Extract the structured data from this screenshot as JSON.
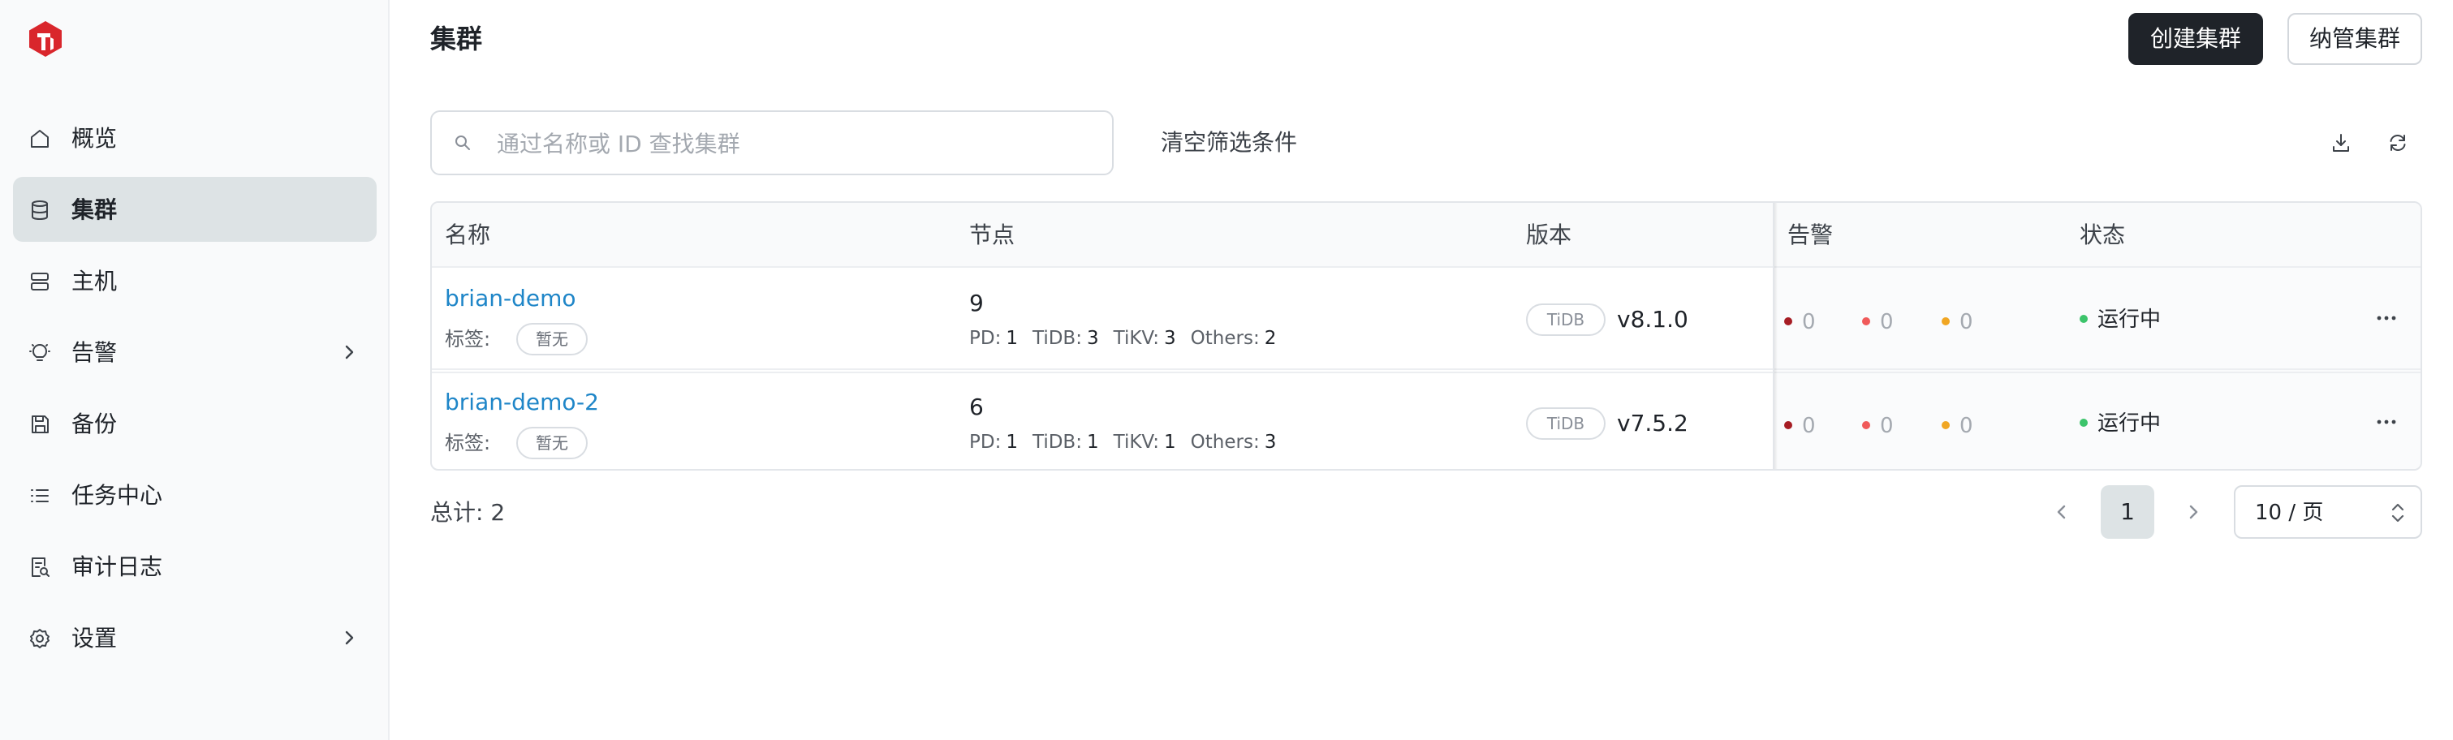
{
  "app": {
    "brand_color": "#d9262c"
  },
  "sidebar": {
    "items": [
      {
        "label": "概览",
        "icon": "home-icon",
        "active": false,
        "has_children": false
      },
      {
        "label": "集群",
        "icon": "database-icon",
        "active": true,
        "has_children": false
      },
      {
        "label": "主机",
        "icon": "server-icon",
        "active": false,
        "has_children": false
      },
      {
        "label": "告警",
        "icon": "bulb-icon",
        "active": false,
        "has_children": true
      },
      {
        "label": "备份",
        "icon": "save-icon",
        "active": false,
        "has_children": false
      },
      {
        "label": "任务中心",
        "icon": "list-icon",
        "active": false,
        "has_children": false
      },
      {
        "label": "审计日志",
        "icon": "audit-log-icon",
        "active": false,
        "has_children": false
      },
      {
        "label": "设置",
        "icon": "gear-icon",
        "active": false,
        "has_children": true
      }
    ]
  },
  "header": {
    "title": "集群",
    "create_label": "创建集群",
    "import_label": "纳管集群"
  },
  "toolbar": {
    "search_placeholder": "通过名称或 ID 查找集群",
    "search_value": "",
    "clear_filter_label": "清空筛选条件"
  },
  "table": {
    "columns": [
      "名称",
      "节点",
      "版本",
      "告警",
      "状态"
    ],
    "rows": [
      {
        "name": "brian-demo",
        "tags_label": "标签:",
        "tag": "暂无",
        "node_total": "9",
        "nodes": {
          "pd_label": "PD:",
          "pd": "1",
          "tidb_label": "TiDB:",
          "tidb": "3",
          "tikv_label": "TiKV:",
          "tikv": "3",
          "others_label": "Others:",
          "others": "2"
        },
        "version_badge": "TiDB",
        "version": "v8.1.0",
        "alerts": {
          "critical": "0",
          "major": "0",
          "warning": "0"
        },
        "status": "运行中"
      },
      {
        "name": "brian-demo-2",
        "tags_label": "标签:",
        "tag": "暂无",
        "node_total": "6",
        "nodes": {
          "pd_label": "PD:",
          "pd": "1",
          "tidb_label": "TiDB:",
          "tidb": "1",
          "tikv_label": "TiKV:",
          "tikv": "1",
          "others_label": "Others:",
          "others": "3"
        },
        "version_badge": "TiDB",
        "version": "v7.5.2",
        "alerts": {
          "critical": "0",
          "major": "0",
          "warning": "0"
        },
        "status": "运行中"
      }
    ],
    "alert_colors": {
      "critical": "#a61d24",
      "major": "#f05a5a",
      "warning": "#f0a623"
    },
    "status_color": "#3cc46b"
  },
  "footer": {
    "total_label": "总计: 2",
    "current_page": "1",
    "page_size_label": "10 / 页"
  }
}
